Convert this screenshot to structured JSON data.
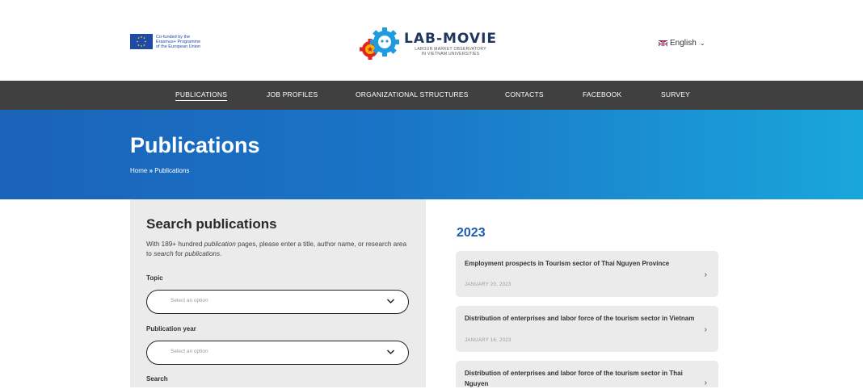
{
  "header": {
    "eu_text": [
      "Co-funded by the",
      "Erasmus+ Programme",
      "of the European Union"
    ],
    "logo_title": "LAB-MOVIE",
    "logo_sub": [
      "LABOUR MARKET OBSERVATORY",
      "IN VIETNAM UNIVERSITIES"
    ],
    "language": "English"
  },
  "nav": [
    "PUBLICATIONS",
    "JOB PROFILES",
    "ORGANIZATIONAL STRUCTURES",
    "CONTACTS",
    "FACEBOOK",
    "SURVEY"
  ],
  "hero": {
    "title": "Publications",
    "breadcrumb_home": "Home",
    "breadcrumb_sep": "»",
    "breadcrumb_current": "Publications"
  },
  "search": {
    "title": "Search publications",
    "intro_1": "With 189+ hundred ",
    "intro_em1": "publication",
    "intro_2": " pages, please enter a title, author name, or research area to ",
    "intro_em2": "search",
    "intro_3": " for ",
    "intro_em3": "publications",
    "intro_4": ".",
    "topic_label": "Topic",
    "topic_placeholder": "Select an option",
    "year_label": "Publication year",
    "year_placeholder": "Select an option",
    "search_label": "Search"
  },
  "list": {
    "year": "2023",
    "items": [
      {
        "title": "Employment prospects in Tourism sector of Thai Nguyen Province",
        "date": "JANUARY 20, 2023",
        "arrow": "›"
      },
      {
        "title": "Distribution of enterprises and labor force of the tourism sector in Vietnam",
        "date": "JANUARY 16, 2023",
        "arrow": "›"
      },
      {
        "title": "Distribution of enterprises and labor force of the tourism sector in Thai Nguyen",
        "date": "",
        "arrow": "›"
      }
    ]
  },
  "colors": {
    "nav_bg": "#404040",
    "hero_start": "#1a63b9",
    "hero_end": "#19a6db",
    "year_blue": "#1b5db0",
    "panel_bg": "#ebebeb"
  }
}
